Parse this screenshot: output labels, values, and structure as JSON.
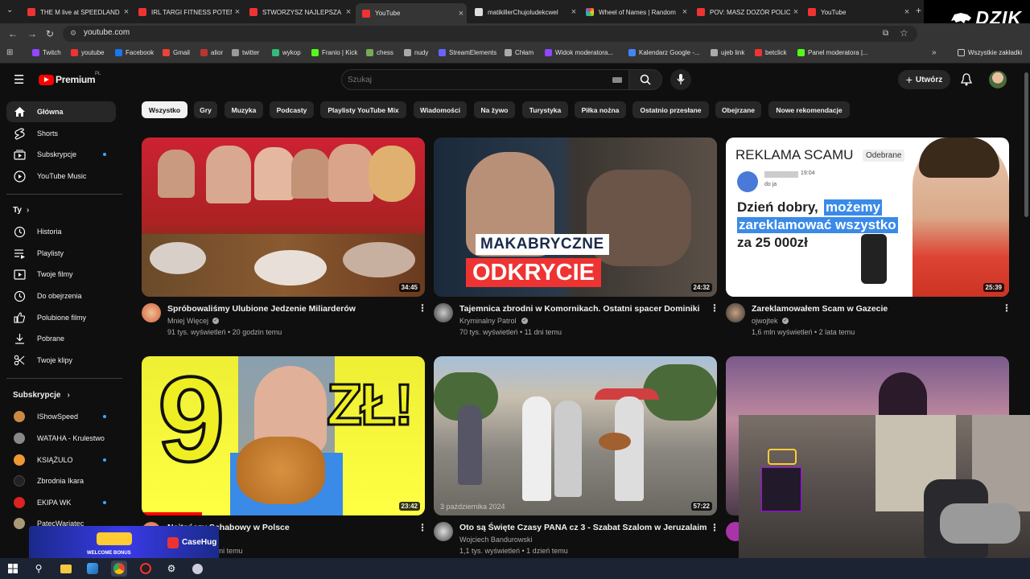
{
  "tabs": [
    {
      "label": "THE M live at SPEEDLAND",
      "color": "#e33"
    },
    {
      "label": "IRL TARGI FITNESS POTEM",
      "color": "#e33"
    },
    {
      "label": "STWORZYSZ NAJLEPSZA",
      "color": "#e33"
    },
    {
      "label": "YouTube",
      "color": "#e33"
    },
    {
      "label": "matikillerChujoludekcwel",
      "color": "#ddd"
    },
    {
      "label": "Wheel of Names | Random",
      "color": "#e8a"
    },
    {
      "label": "POV: MASZ DOZÓR POLICJ",
      "color": "#e33"
    },
    {
      "label": "YouTube",
      "color": "#e33"
    }
  ],
  "brand": {
    "logo_text": "DZIK"
  },
  "address": {
    "url": "youtube.com"
  },
  "bookmarks": [
    {
      "label": "Twitch",
      "color": "#9146ff"
    },
    {
      "label": "youtube",
      "color": "#e33"
    },
    {
      "label": "Facebook",
      "color": "#1877f2"
    },
    {
      "label": "Gmail",
      "color": "#ea4335"
    },
    {
      "label": "alior",
      "color": "#b33"
    },
    {
      "label": "twitter",
      "color": "#999"
    },
    {
      "label": "wykop",
      "color": "#3b7"
    },
    {
      "label": "Franio | Kick",
      "color": "#53fc18"
    },
    {
      "label": "chess",
      "color": "#7a5"
    },
    {
      "label": "nudy",
      "color": "#aaa"
    },
    {
      "label": "StreamElements",
      "color": "#66f"
    },
    {
      "label": "Chłam",
      "color": "#aaa"
    },
    {
      "label": "Widok moderatora...",
      "color": "#9146ff"
    },
    {
      "label": "Kalendarz Google -...",
      "color": "#4285f4"
    },
    {
      "label": "ujeb link",
      "color": "#aaa"
    },
    {
      "label": "betclick",
      "color": "#e33"
    },
    {
      "label": "Panel moderatora |...",
      "color": "#53fc18"
    }
  ],
  "bookmarks_all": "Wszystkie zakładki",
  "youtube": {
    "logo": "Premium",
    "logo_sup": "PL",
    "search_placeholder": "Szukaj",
    "create_label": "Utwórz"
  },
  "sidebar": {
    "main": [
      {
        "label": "Główna",
        "icon": "home-icon",
        "selected": true
      },
      {
        "label": "Shorts",
        "icon": "shorts-icon"
      },
      {
        "label": "Subskrypcje",
        "icon": "subscriptions-icon",
        "dot": true
      },
      {
        "label": "YouTube Music",
        "icon": "music-icon"
      }
    ],
    "you_header": "Ty",
    "you": [
      {
        "label": "Historia",
        "icon": "history-icon"
      },
      {
        "label": "Playlisty",
        "icon": "playlist-icon"
      },
      {
        "label": "Twoje filmy",
        "icon": "your-videos-icon"
      },
      {
        "label": "Do obejrzenia",
        "icon": "watch-later-icon"
      },
      {
        "label": "Polubione filmy",
        "icon": "like-icon"
      },
      {
        "label": "Pobrane",
        "icon": "download-icon"
      },
      {
        "label": "Twoje klipy",
        "icon": "clips-icon"
      }
    ],
    "subs_header": "Subskrypcje",
    "subs": [
      {
        "label": "IShowSpeed",
        "color": "#c84",
        "dot": true
      },
      {
        "label": "WATAHA - Krulestwo",
        "color": "#888"
      },
      {
        "label": "KSIĄŻULO",
        "color": "#e93",
        "dot": true
      },
      {
        "label": "Zbrodnia Ikara",
        "color": "#222"
      },
      {
        "label": "EKIPA WK",
        "color": "#d22",
        "dot": true
      },
      {
        "label": "PatecWariatec",
        "color": "#a97"
      }
    ]
  },
  "chips": [
    "Wszystko",
    "Gry",
    "Muzyka",
    "Podcasty",
    "Playlisty YouTube Mix",
    "Wiadomości",
    "Na żywo",
    "Turystyka",
    "Piłka nożna",
    "Ostatnio przesłane",
    "Obejrzane",
    "Nowe rekomendacje"
  ],
  "videos": [
    {
      "title": "Spróbowaliśmy Ulubione Jedzenie Miliarderów",
      "channel": "Mniej Więcej",
      "meta": "91 tys. wyświetleń • 20 godzin temu",
      "duration": "34:45",
      "bg": "#b33"
    },
    {
      "title": "Tajemnica zbrodni w Komornikach. Ostatni spacer Dominiki",
      "channel": "Kryminalny Patrol",
      "meta": "70 tys. wyświetleń • 11 dni temu",
      "duration": "24:32",
      "bg": "#222",
      "overlay1": "MAKABRYCZNE",
      "overlay2": "ODKRYCIE"
    },
    {
      "title": "Zareklamowałem Scam w Gazecie",
      "channel": "ojwojtek",
      "meta": "1,6 mln wyświetleń • 2 lata temu",
      "duration": "25:39",
      "bg": "#fff",
      "t1": "REKLAMA SCAMU",
      "t2": "Odebrane",
      "t3": "Dzień dobry,",
      "t4": "możemy",
      "t5": "zareklamować wszystko",
      "t6": "za 25 000zł",
      "t7": "19:04",
      "t8": "do ja"
    },
    {
      "title": "Najtańszy Schabowy w Polsce",
      "channel": "",
      "meta": "wyświetleń • 9 dni temu",
      "duration": "23:42",
      "bg": "#ee3",
      "big": "9 ZŁ!"
    },
    {
      "title": "Oto są Święte Czasy PANA cz 3 - Szabat Szalom w Jeruzalaim",
      "channel": "Wojciech Bandurowski",
      "meta": "1,1 tys. wyświetleń • 1 dzień temu",
      "duration": "57:22",
      "bg": "#8a8",
      "stamp": "3 października 2024"
    },
    {
      "title": "",
      "channel": "",
      "meta": "",
      "duration": "",
      "bg": "#5a4a6a"
    }
  ],
  "promo": {
    "text": "WELCOME BONUS",
    "brand": "CaseHug"
  }
}
